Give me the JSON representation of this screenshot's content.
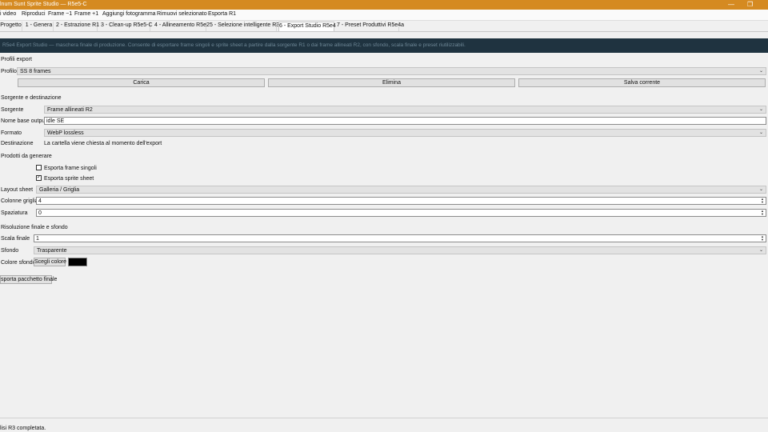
{
  "window": {
    "title": "lnum Sunt Sprite Studio — R5e5-C",
    "minimize_glyph": "—",
    "maximize_glyph": "❐",
    "close_glyph": "✕"
  },
  "toolbar": {
    "items": [
      "i video",
      "Riproduci",
      "Frame −1",
      "Frame +1",
      "Aggiungi fotogramma",
      "Rimuovi selezionato",
      "Esporta R1"
    ]
  },
  "tabs": [
    {
      "label": "Progetto"
    },
    {
      "label": "1 - Genera"
    },
    {
      "label": "2 - Estrazione R1"
    },
    {
      "label": "3 - Clean-up R5e5-C"
    },
    {
      "label": "4 - Allineamento R5e2"
    },
    {
      "label": "5 - Selezione intelligente R3"
    },
    {
      "label": "6 - Export Studio R5e4",
      "active": true
    },
    {
      "label": "7 - Preset Produttivi R5e4a"
    }
  ],
  "banner": {
    "text": "R5e4 Export Studio — maschera finale di produzione. Consente di esportare frame singoli e sprite sheet a partire dalla sorgente R1 o dai frame allineati R2, con sfondo, scala finale e preset riutilizzabili."
  },
  "profiles": {
    "section_title": "Profili export",
    "profile_label": "Profilo",
    "profile_value": "SS 8 frames",
    "load_label": "Carica",
    "delete_label": "Elimina",
    "save_label": "Salva corrente"
  },
  "source": {
    "section_title": "Sorgente e destinazione",
    "source_label": "Sorgente",
    "source_value": "Frame allineati R2",
    "basename_label": "Nome base output",
    "basename_value": "idle SE",
    "format_label": "Formato",
    "format_value": "WebP lossless",
    "destination_label": "Destinazione",
    "destination_value": "La cartella viene chiesta al momento dell'export"
  },
  "products": {
    "section_title": "Prodotti da generare",
    "single_frames_label": "Esporta frame singoli",
    "single_frames_checked": false,
    "sprite_sheet_label": "Esporta sprite sheet",
    "sprite_sheet_checked": true,
    "layout_label": "Layout sheet",
    "layout_value": "Galleria / Griglia",
    "columns_label": "Colonne griglia",
    "columns_value": "4",
    "spacing_label": "Spaziatura",
    "spacing_value": "0"
  },
  "resolution": {
    "section_title": "Risoluzione finale e sfondo",
    "scale_label": "Scala finale",
    "scale_value": "1",
    "background_label": "Sfondo",
    "background_value": "Trasparente",
    "bg_color_label": "Colore sfondo",
    "choose_color_label": "Scegli colore",
    "bg_color": "#000000"
  },
  "export_button_label": "sporta pacchetto finale",
  "status": {
    "text": "lisi R3 completata."
  },
  "icons": {
    "dropdown_glyph": "⌄",
    "check_glyph": "✓",
    "spin_up_glyph": "▲",
    "spin_down_glyph": "▼"
  },
  "colors": {
    "titlebar": "#d58a21",
    "banner": "#1f3340"
  }
}
